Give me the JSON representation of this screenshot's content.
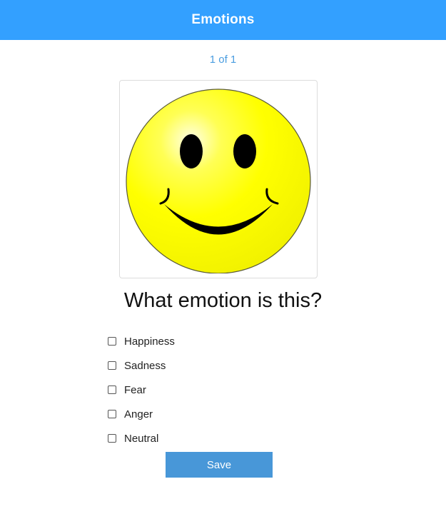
{
  "header": {
    "title": "Emotions"
  },
  "pager": {
    "text": "1 of 1"
  },
  "image": {
    "subject": "smiley-face-icon",
    "face_color": "#ffff00"
  },
  "question": {
    "text": "What emotion is this?"
  },
  "options": [
    {
      "label": "Happiness",
      "checked": false
    },
    {
      "label": "Sadness",
      "checked": false
    },
    {
      "label": "Fear",
      "checked": false
    },
    {
      "label": "Anger",
      "checked": false
    },
    {
      "label": "Neutral",
      "checked": false
    }
  ],
  "actions": {
    "save_label": "Save"
  },
  "colors": {
    "header_bg": "#33a0ff",
    "accent": "#4897d8",
    "pager_text": "#4a9de0"
  }
}
